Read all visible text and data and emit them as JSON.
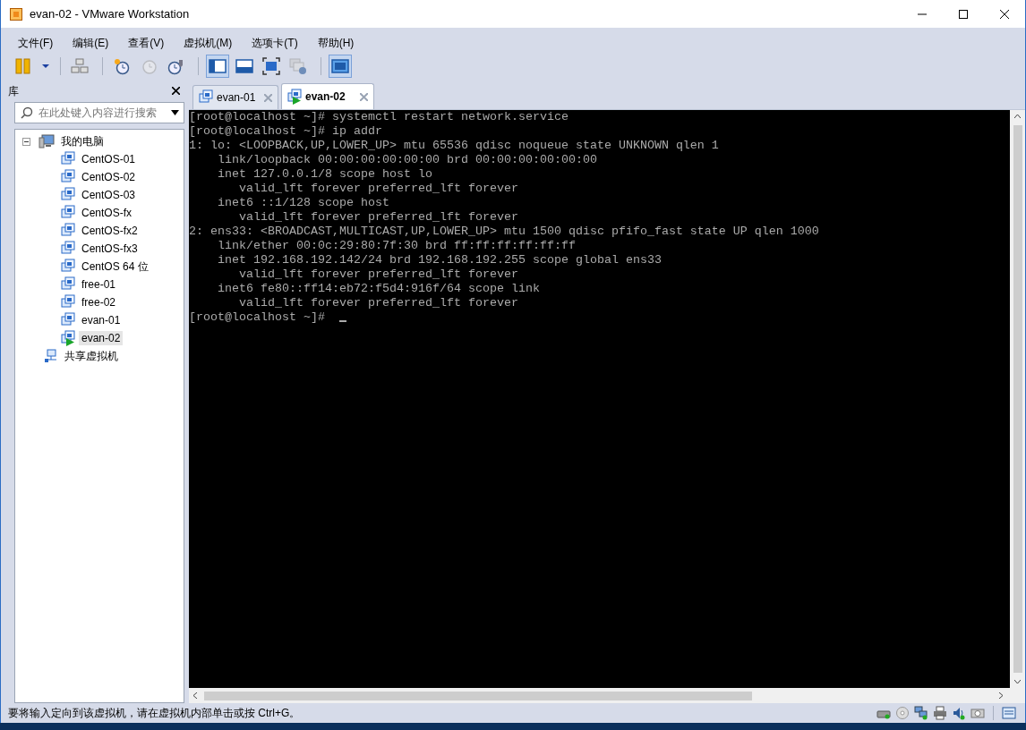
{
  "window": {
    "title": "evan-02 - VMware Workstation"
  },
  "menu": [
    "文件(F)",
    "编辑(E)",
    "查看(V)",
    "虚拟机(M)",
    "选项卡(T)",
    "帮助(H)"
  ],
  "toolbar": [
    {
      "kind": "pause",
      "pressed": false,
      "disabled": false
    },
    {
      "kind": "dropdown",
      "pressed": false,
      "disabled": false
    },
    {
      "kind": "sep"
    },
    {
      "kind": "network",
      "pressed": false,
      "disabled": false
    },
    {
      "kind": "sep"
    },
    {
      "kind": "snapshot",
      "pressed": false,
      "disabled": false
    },
    {
      "kind": "revert",
      "pressed": false,
      "disabled": true
    },
    {
      "kind": "manage",
      "pressed": false,
      "disabled": false
    },
    {
      "kind": "sep"
    },
    {
      "kind": "library",
      "pressed": true,
      "disabled": false
    },
    {
      "kind": "thumbs",
      "pressed": false,
      "disabled": false
    },
    {
      "kind": "fullscreen",
      "pressed": false,
      "disabled": false
    },
    {
      "kind": "unity",
      "pressed": false,
      "disabled": true
    },
    {
      "kind": "sep"
    },
    {
      "kind": "console",
      "pressed": true,
      "disabled": false
    }
  ],
  "library": {
    "title": "库",
    "search": {
      "placeholder": "在此处键入内容进行搜索"
    },
    "tree": [
      {
        "label": "我的电脑",
        "kind": "computer",
        "expanded": true,
        "children": [
          {
            "label": "CentOS-01",
            "selected": false,
            "running": false
          },
          {
            "label": "CentOS-02",
            "selected": false,
            "running": false
          },
          {
            "label": "CentOS-03",
            "selected": false,
            "running": false
          },
          {
            "label": "CentOS-fx",
            "selected": false,
            "running": false
          },
          {
            "label": "CentOS-fx2",
            "selected": false,
            "running": false
          },
          {
            "label": "CentOS-fx3",
            "selected": false,
            "running": false
          },
          {
            "label": "CentOS 64 位",
            "selected": false,
            "running": false
          },
          {
            "label": "free-01",
            "selected": false,
            "running": false
          },
          {
            "label": "free-02",
            "selected": false,
            "running": false
          },
          {
            "label": "evan-01",
            "selected": false,
            "running": false
          },
          {
            "label": "evan-02",
            "selected": true,
            "running": true
          }
        ]
      },
      {
        "label": "共享虚拟机",
        "kind": "shared"
      }
    ]
  },
  "tabs": [
    {
      "label": "evan-01",
      "selected": false,
      "running": false
    },
    {
      "label": "evan-02",
      "selected": true,
      "running": true
    }
  ],
  "terminal": {
    "lines": [
      "[root@localhost ~]# systemctl restart network.service",
      "[root@localhost ~]# ip addr",
      "1: lo: <LOOPBACK,UP,LOWER_UP> mtu 65536 qdisc noqueue state UNKNOWN qlen 1",
      "    link/loopback 00:00:00:00:00:00 brd 00:00:00:00:00:00",
      "    inet 127.0.0.1/8 scope host lo",
      "       valid_lft forever preferred_lft forever",
      "    inet6 ::1/128 scope host",
      "       valid_lft forever preferred_lft forever",
      "2: ens33: <BROADCAST,MULTICAST,UP,LOWER_UP> mtu 1500 qdisc pfifo_fast state UP qlen 1000",
      "    link/ether 00:0c:29:80:7f:30 brd ff:ff:ff:ff:ff:ff",
      "    inet 192.168.192.142/24 brd 192.168.192.255 scope global ens33",
      "       valid_lft forever preferred_lft forever",
      "    inet6 fe80::ff14:eb72:f5d4:916f/64 scope link",
      "       valid_lft forever preferred_lft forever",
      "[root@localhost ~]# "
    ],
    "cursor": true
  },
  "status_bar": {
    "text": "要将输入定向到该虚拟机，请在虚拟机内部单击或按 Ctrl+G。"
  }
}
